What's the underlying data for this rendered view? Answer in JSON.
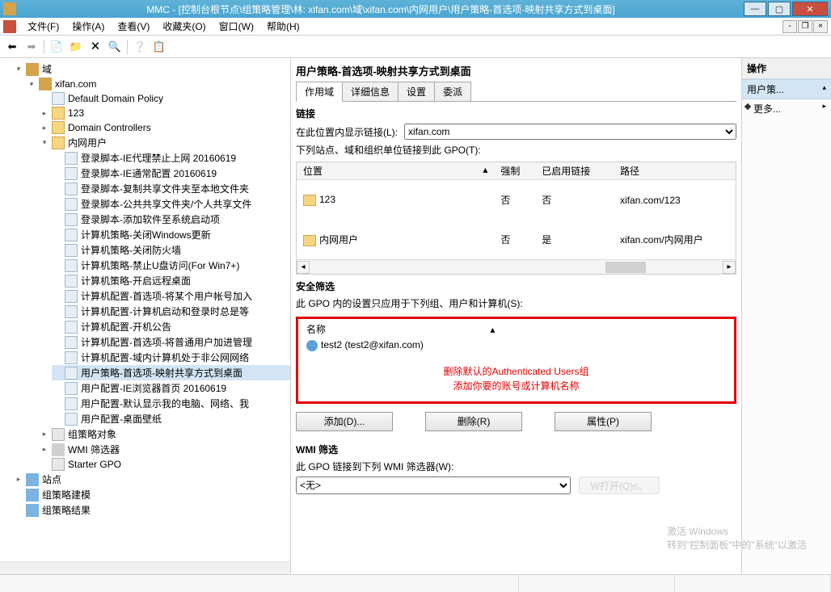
{
  "titlebar": {
    "title": "MMC - [控制台根节点\\组策略管理\\林: xifan.com\\域\\xifan.com\\内网用户\\用户策略-首选项-映射共享方式到桌面]"
  },
  "menu": {
    "file": "文件(F)",
    "operate": "操作(A)",
    "view": "查看(V)",
    "favorites": "收藏夹(O)",
    "window": "窗口(W)",
    "help": "帮助(H)"
  },
  "tree": {
    "root": "域",
    "domain": "xifan.com",
    "ddp": "Default Domain Policy",
    "n123": "123",
    "dc": "Domain Controllers",
    "intranet": "内网用户",
    "items": [
      "登录脚本-IE代理禁止上网 20160619",
      "登录脚本-IE通常配置 20160619",
      "登录脚本-复制共享文件夹至本地文件夹",
      "登录脚本-公共共享文件夹/个人共享文件",
      "登录脚本-添加软件至系统启动项",
      "计算机策略-关闭Windows更新",
      "计算机策略-关闭防火墙",
      "计算机策略-禁止U盘访问(For Win7+)",
      "计算机策略-开启远程桌面",
      "计算机配置-首选项-将某个用户帐号加入",
      "计算机配置-计算机启动和登录时总是等",
      "计算机配置-开机公告",
      "计算机配置-首选项-将普通用户加进管理",
      "计算机配置-域内计算机处于非公网网络",
      "用户策略-首选项-映射共享方式到桌面",
      "用户配置-IE浏览器首页 20160619",
      "用户配置-默认显示我的电脑、网络、我",
      "用户配置-桌面壁纸"
    ],
    "gpo_obj": "组策略对象",
    "wmi_filter": "WMI 筛选器",
    "starter": "Starter GPO",
    "sites": "站点",
    "gpm_model": "组策略建模",
    "gpm_result": "组策略结果"
  },
  "mid": {
    "title": "用户策略-首选项-映射共享方式到桌面",
    "tabs": {
      "scope": "作用域",
      "detail": "详细信息",
      "settings": "设置",
      "delegate": "委派"
    },
    "links_title": "链接",
    "show_links": "在此位置内显示链接(L):",
    "dropdown_val": "xifan.com",
    "sites_label": "下列站点、域和组织单位链接到此 GPO(T):",
    "cols": {
      "loc": "位置",
      "enforce": "强制",
      "enabled": "已启用链接",
      "path": "路径"
    },
    "rows": [
      {
        "loc": "123",
        "enforce": "否",
        "enabled": "否",
        "path": "xifan.com/123"
      },
      {
        "loc": "内网用户",
        "enforce": "否",
        "enabled": "是",
        "path": "xifan.com/内网用户"
      }
    ],
    "sec_title": "安全筛选",
    "sec_sub": "此 GPO 内的设置只应用于下列组、用户和计算机(S):",
    "sec_col": "名称",
    "sec_entry": "test2 (test2@xifan.com)",
    "annotation1": "删除默认的Authenticated Users组",
    "annotation2": "添加你要的账号或计算机名称",
    "btn_add": "添加(D)...",
    "btn_del": "删除(R)",
    "btn_prop": "属性(P)",
    "wmi_title": "WMI 筛选",
    "wmi_sub": "此 GPO 链接到下列 WMI 筛选器(W):",
    "wmi_val": "<无>",
    "wmi_open": "W打开(Q)s。"
  },
  "actions": {
    "title": "操作",
    "group": "用户策...",
    "more": "更多..."
  },
  "watermark": {
    "line1": "激活 Windows",
    "line2": "转到\"控制面板\"中的\"系统\"以激活"
  }
}
